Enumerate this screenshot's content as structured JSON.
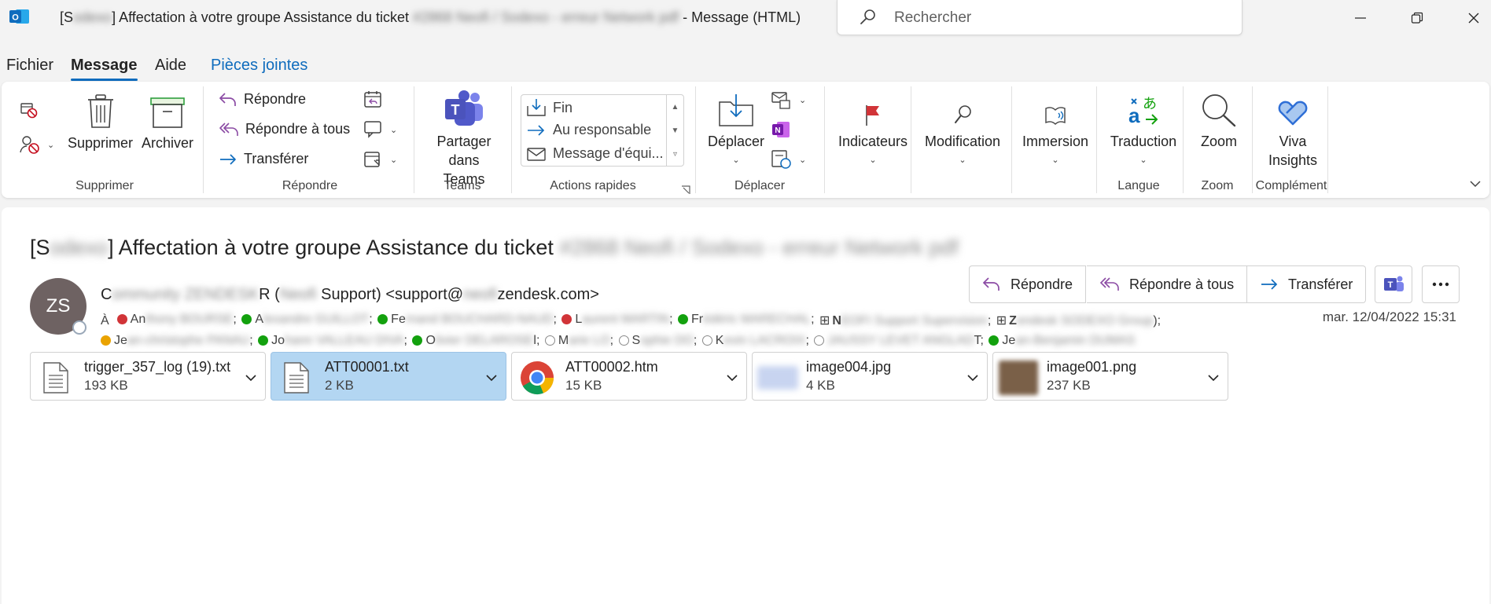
{
  "titlebar": {
    "title_prefix": "[S",
    "title_blur1": "odexo",
    "title_main": "] Affectation à votre groupe Assistance du ticket ",
    "title_blur2": "#2868 Neofi / Sodexo - erreur Network pdf",
    "title_suffix": "  -  Message (HTML)",
    "search_placeholder": "Rechercher"
  },
  "menu": {
    "tabs": [
      "Fichier",
      "Message",
      "Aide",
      "Pièces jointes"
    ]
  },
  "ribbon": {
    "delete_group": {
      "delete_label": "Supprimer",
      "archive_label": "Archiver",
      "group_label": "Supprimer"
    },
    "respond_group": {
      "reply": "Répondre",
      "reply_all": "Répondre à tous",
      "forward": "Transférer",
      "group_label": "Répondre"
    },
    "teams_group": {
      "share_line1": "Partager",
      "share_line2": "dans Teams",
      "group_label": "Teams"
    },
    "quick_group": {
      "items": [
        "Fin",
        "Au responsable",
        "Message d'équi..."
      ],
      "group_label": "Actions rapides"
    },
    "move_group": {
      "move_label": "Déplacer",
      "group_label": "Déplacer"
    },
    "tags": {
      "label": "Indicateurs"
    },
    "edit": {
      "label": "Modification"
    },
    "immersive": {
      "label": "Immersion"
    },
    "language_group": {
      "translate": "Traduction",
      "group_label": "Langue"
    },
    "zoom_group": {
      "zoom": "Zoom",
      "group_label": "Zoom"
    },
    "addin_group": {
      "viva_line1": "Viva",
      "viva_line2": "Insights",
      "group_label": "Complément"
    }
  },
  "message": {
    "subject_prefix": "[S",
    "subject_blur1": "odexo",
    "subject_main": "] Affectation à votre groupe Assistance du ticket ",
    "subject_blur2": "#2868 Neofi / Sodexo - erreur Network pdf",
    "avatar_initials": "ZS",
    "sender_c": "C",
    "sender_blur1": "ommunity ZENDESK",
    "sender_r": "R (",
    "sender_blur2": "Neofi",
    "sender_mid": " Support) <support@",
    "sender_blur3": "neofi",
    "sender_end": "zendesk.com>",
    "to_label": "À",
    "date": "mar. 12/04/2022 15:31",
    "actions": {
      "reply": "Répondre",
      "reply_all": "Répondre à tous",
      "forward": "Transférer"
    }
  },
  "attachments": [
    {
      "name": "trigger_357_log (19).txt",
      "size": "193 KB"
    },
    {
      "name": "ATT00001.txt",
      "size": "2 KB"
    },
    {
      "name": "ATT00002.htm",
      "size": "15 KB"
    },
    {
      "name": "image004.jpg",
      "size": "4 KB"
    },
    {
      "name": "image001.png",
      "size": "237 KB"
    }
  ],
  "colors": {
    "accent": "#0f6cbd",
    "selected_attachment": "#b3d6f2",
    "avatar": "#6e6262"
  }
}
